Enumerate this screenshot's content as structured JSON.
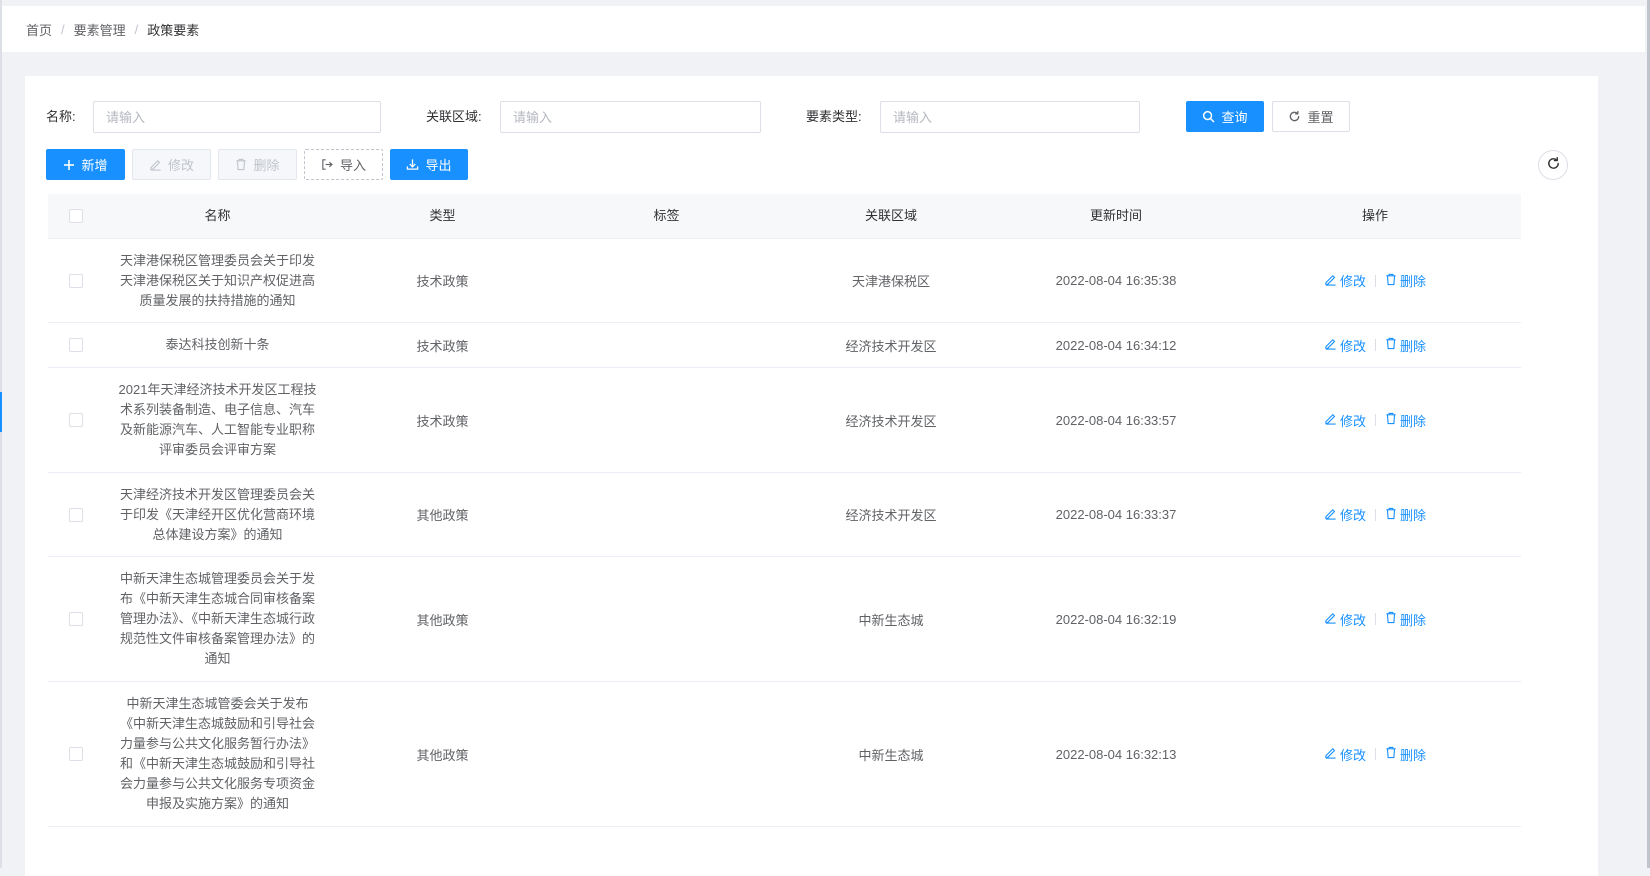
{
  "breadcrumb": [
    "首页",
    "要素管理",
    "政策要素"
  ],
  "search": {
    "name_label": "名称:",
    "name_placeholder": "请输入",
    "region_label": "关联区域:",
    "region_placeholder": "请输入",
    "type_label": "要素类型:",
    "type_placeholder": "请输入",
    "query_label": "查询",
    "reset_label": "重置"
  },
  "toolbar": {
    "add_label": "新增",
    "edit_label": "修改",
    "delete_label": "删除",
    "import_label": "导入",
    "export_label": "导出"
  },
  "table": {
    "headers": [
      "名称",
      "类型",
      "标签",
      "关联区域",
      "更新时间",
      "操作"
    ],
    "edit_label": "修改",
    "delete_label": "删除",
    "rows": [
      {
        "name": "天津港保税区管理委员会关于印发天津港保税区关于知识产权促进高质量发展的扶持措施的通知",
        "type": "技术政策",
        "tag": "",
        "region": "天津港保税区",
        "updated": "2022-08-04 16:35:38"
      },
      {
        "name": "泰达科技创新十条",
        "type": "技术政策",
        "tag": "",
        "region": "经济技术开发区",
        "updated": "2022-08-04 16:34:12"
      },
      {
        "name": "2021年天津经济技术开发区工程技术系列装备制造、电子信息、汽车及新能源汽车、人工智能专业职称评审委员会评审方案",
        "type": "技术政策",
        "tag": "",
        "region": "经济技术开发区",
        "updated": "2022-08-04 16:33:57"
      },
      {
        "name": "天津经济技术开发区管理委员会关于印发《天津经开区优化营商环境总体建设方案》的通知",
        "type": "其他政策",
        "tag": "",
        "region": "经济技术开发区",
        "updated": "2022-08-04 16:33:37"
      },
      {
        "name": "中新天津生态城管理委员会关于发布《中新天津生态城合同审核备案管理办法》、《中新天津生态城行政规范性文件审核备案管理办法》的通知",
        "type": "其他政策",
        "tag": "",
        "region": "中新生态城",
        "updated": "2022-08-04 16:32:19"
      },
      {
        "name": "中新天津生态城管委会关于发布《中新天津生态城鼓励和引导社会力量参与公共文化服务暂行办法》和《中新天津生态城鼓励和引导社会力量参与公共文化服务专项资金申报及实施方案》的通知",
        "type": "其他政策",
        "tag": "",
        "region": "中新生态城",
        "updated": "2022-08-04 16:32:13"
      }
    ]
  },
  "colors": {
    "primary": "#1890ff",
    "border": "#dcdfe6",
    "background": "#f0f2f5"
  }
}
